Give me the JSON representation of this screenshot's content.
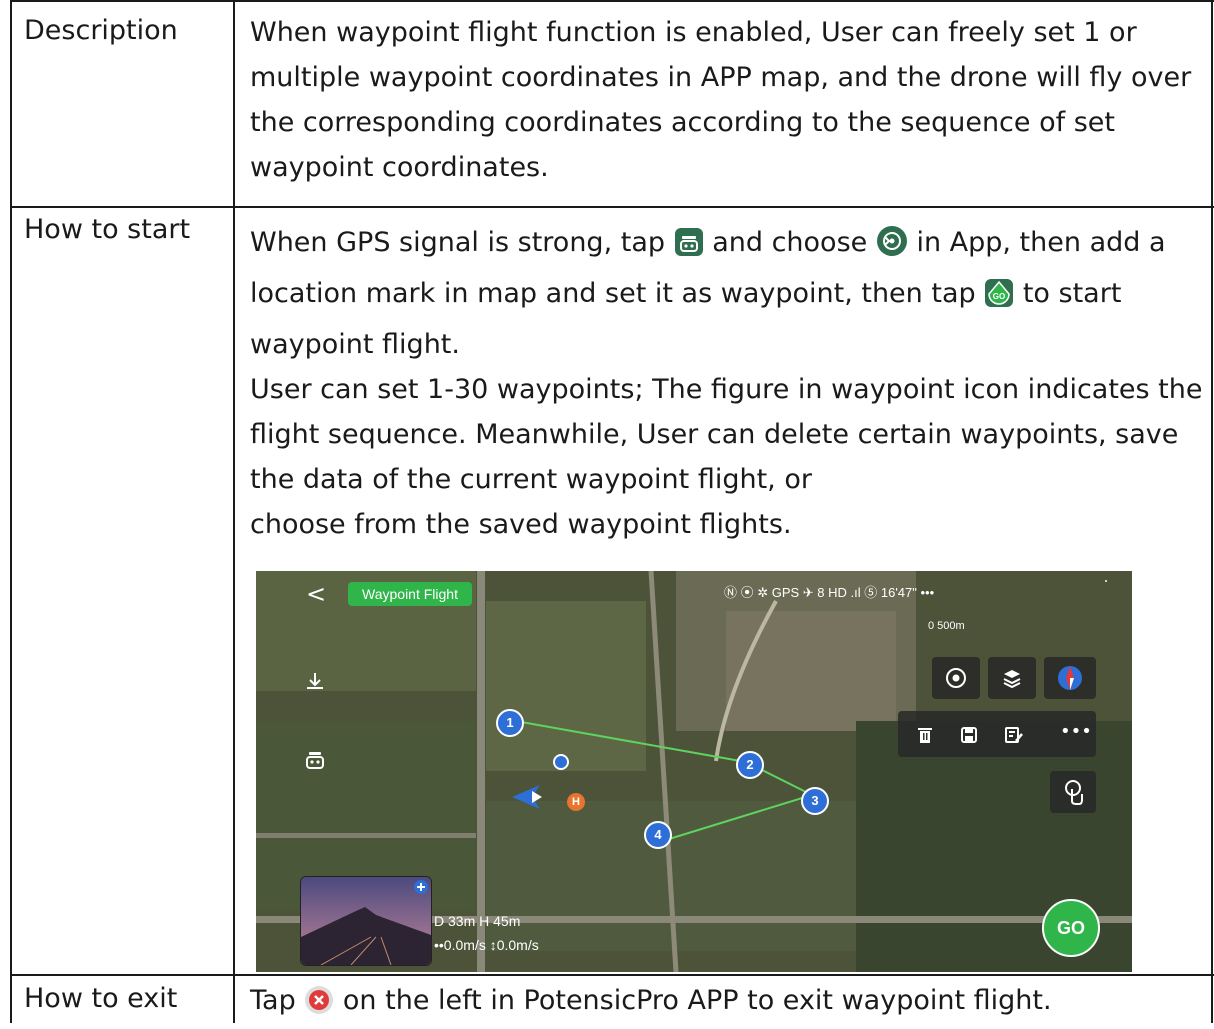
{
  "rows": [
    {
      "label": "Description",
      "paragraphs": [
        "When waypoint flight function is enabled, User can freely set 1 or",
        "multiple waypoint coordinates in APP map, and the drone will fly over",
        "the corresponding coordinates according to the sequence of set",
        "waypoint coordinates."
      ]
    },
    {
      "label": "How to start",
      "line1_a": "When GPS signal is strong, tap",
      "line1_b": "and choose",
      "line1_c": "in App, then add a",
      "line2_a": "location mark in map and set it as waypoint, then tap",
      "line2_b": "to start",
      "line3": "waypoint flight.",
      "line4": "User can set 1-30 waypoints; The figure in waypoint icon indicates the",
      "line5": "flight sequence. Meanwhile, User can delete certain waypoints, save",
      "line6": "the data of the current waypoint flight, or",
      "line7": "choose from the saved waypoint flights."
    },
    {
      "label": "How to exit",
      "text_a": "Tap",
      "text_b": "on the left in PotensicPro APP to exit waypoint flight."
    }
  ],
  "screenshot": {
    "mode_label": "Waypoint Flight",
    "back_glyph": "<",
    "status_text": "Ⓝ ⦿ ✲ GPS ✈ 8 HD .ıl ⑤ 16'47\"   •••",
    "scale_label": "0    500m",
    "waypoints": [
      "1",
      "2",
      "3",
      "4"
    ],
    "home_label": "H",
    "telemetry_line1": "D 33m    H 45m",
    "telemetry_line2": "••0.0m/s ↕0.0m/s",
    "go_label": "GO",
    "go_small_label": "GO",
    "toolbar_more": "•••"
  },
  "colors": {
    "accent_green": "#2fb54a",
    "waypoint_blue": "#2d6fd6",
    "route_green": "#5fd35f",
    "exit_red": "#e03a3a"
  }
}
